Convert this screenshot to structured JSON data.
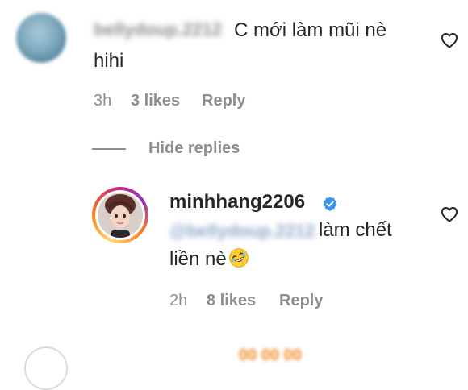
{
  "comment": {
    "username_blurred": "bellydoup.2212",
    "text_line1": "C mới làm mũi nè",
    "text_line2": "hihi",
    "time": "3h",
    "likes": "3 likes",
    "reply_label": "Reply",
    "like_icon": "heart-outline"
  },
  "hide_replies_label": "Hide replies",
  "reply": {
    "username": "minhhang2206",
    "verified_icon": "verified-badge",
    "mention_blurred": "@bellydoup.2212",
    "text_line1": "làm chết",
    "text_line2": "liền nè",
    "emoji_icon": "rolling-on-floor-laughing",
    "time": "2h",
    "likes": "8 likes",
    "reply_label": "Reply",
    "like_icon": "heart-outline"
  },
  "next_comment_blurred": "00 00 00",
  "colors": {
    "text": "#262626",
    "secondary": "#8e8e8e",
    "verified_blue": "#3897f0",
    "story_ring_start": "#feda75",
    "story_ring_end": "#d62976"
  }
}
